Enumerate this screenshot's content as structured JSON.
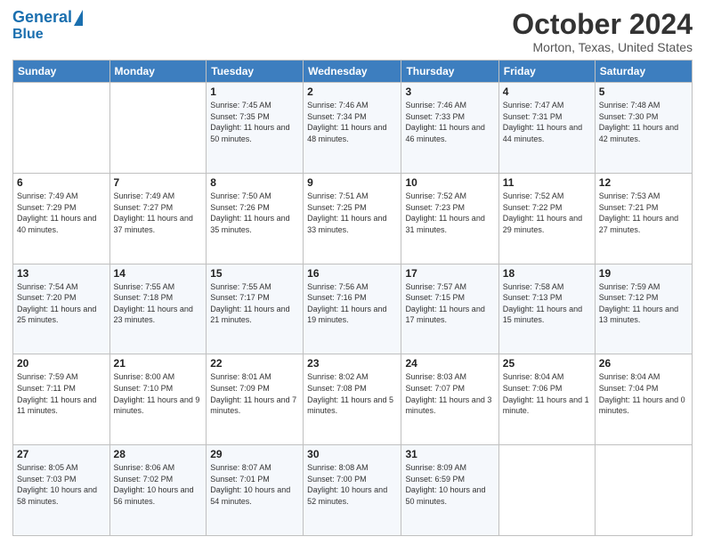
{
  "header": {
    "logo_line1": "General",
    "logo_line2": "Blue",
    "main_title": "October 2024",
    "subtitle": "Morton, Texas, United States"
  },
  "days_of_week": [
    "Sunday",
    "Monday",
    "Tuesday",
    "Wednesday",
    "Thursday",
    "Friday",
    "Saturday"
  ],
  "weeks": [
    [
      {
        "day": "",
        "info": ""
      },
      {
        "day": "",
        "info": ""
      },
      {
        "day": "1",
        "info": "Sunrise: 7:45 AM\nSunset: 7:35 PM\nDaylight: 11 hours and 50 minutes."
      },
      {
        "day": "2",
        "info": "Sunrise: 7:46 AM\nSunset: 7:34 PM\nDaylight: 11 hours and 48 minutes."
      },
      {
        "day": "3",
        "info": "Sunrise: 7:46 AM\nSunset: 7:33 PM\nDaylight: 11 hours and 46 minutes."
      },
      {
        "day": "4",
        "info": "Sunrise: 7:47 AM\nSunset: 7:31 PM\nDaylight: 11 hours and 44 minutes."
      },
      {
        "day": "5",
        "info": "Sunrise: 7:48 AM\nSunset: 7:30 PM\nDaylight: 11 hours and 42 minutes."
      }
    ],
    [
      {
        "day": "6",
        "info": "Sunrise: 7:49 AM\nSunset: 7:29 PM\nDaylight: 11 hours and 40 minutes."
      },
      {
        "day": "7",
        "info": "Sunrise: 7:49 AM\nSunset: 7:27 PM\nDaylight: 11 hours and 37 minutes."
      },
      {
        "day": "8",
        "info": "Sunrise: 7:50 AM\nSunset: 7:26 PM\nDaylight: 11 hours and 35 minutes."
      },
      {
        "day": "9",
        "info": "Sunrise: 7:51 AM\nSunset: 7:25 PM\nDaylight: 11 hours and 33 minutes."
      },
      {
        "day": "10",
        "info": "Sunrise: 7:52 AM\nSunset: 7:23 PM\nDaylight: 11 hours and 31 minutes."
      },
      {
        "day": "11",
        "info": "Sunrise: 7:52 AM\nSunset: 7:22 PM\nDaylight: 11 hours and 29 minutes."
      },
      {
        "day": "12",
        "info": "Sunrise: 7:53 AM\nSunset: 7:21 PM\nDaylight: 11 hours and 27 minutes."
      }
    ],
    [
      {
        "day": "13",
        "info": "Sunrise: 7:54 AM\nSunset: 7:20 PM\nDaylight: 11 hours and 25 minutes."
      },
      {
        "day": "14",
        "info": "Sunrise: 7:55 AM\nSunset: 7:18 PM\nDaylight: 11 hours and 23 minutes."
      },
      {
        "day": "15",
        "info": "Sunrise: 7:55 AM\nSunset: 7:17 PM\nDaylight: 11 hours and 21 minutes."
      },
      {
        "day": "16",
        "info": "Sunrise: 7:56 AM\nSunset: 7:16 PM\nDaylight: 11 hours and 19 minutes."
      },
      {
        "day": "17",
        "info": "Sunrise: 7:57 AM\nSunset: 7:15 PM\nDaylight: 11 hours and 17 minutes."
      },
      {
        "day": "18",
        "info": "Sunrise: 7:58 AM\nSunset: 7:13 PM\nDaylight: 11 hours and 15 minutes."
      },
      {
        "day": "19",
        "info": "Sunrise: 7:59 AM\nSunset: 7:12 PM\nDaylight: 11 hours and 13 minutes."
      }
    ],
    [
      {
        "day": "20",
        "info": "Sunrise: 7:59 AM\nSunset: 7:11 PM\nDaylight: 11 hours and 11 minutes."
      },
      {
        "day": "21",
        "info": "Sunrise: 8:00 AM\nSunset: 7:10 PM\nDaylight: 11 hours and 9 minutes."
      },
      {
        "day": "22",
        "info": "Sunrise: 8:01 AM\nSunset: 7:09 PM\nDaylight: 11 hours and 7 minutes."
      },
      {
        "day": "23",
        "info": "Sunrise: 8:02 AM\nSunset: 7:08 PM\nDaylight: 11 hours and 5 minutes."
      },
      {
        "day": "24",
        "info": "Sunrise: 8:03 AM\nSunset: 7:07 PM\nDaylight: 11 hours and 3 minutes."
      },
      {
        "day": "25",
        "info": "Sunrise: 8:04 AM\nSunset: 7:06 PM\nDaylight: 11 hours and 1 minute."
      },
      {
        "day": "26",
        "info": "Sunrise: 8:04 AM\nSunset: 7:04 PM\nDaylight: 11 hours and 0 minutes."
      }
    ],
    [
      {
        "day": "27",
        "info": "Sunrise: 8:05 AM\nSunset: 7:03 PM\nDaylight: 10 hours and 58 minutes."
      },
      {
        "day": "28",
        "info": "Sunrise: 8:06 AM\nSunset: 7:02 PM\nDaylight: 10 hours and 56 minutes."
      },
      {
        "day": "29",
        "info": "Sunrise: 8:07 AM\nSunset: 7:01 PM\nDaylight: 10 hours and 54 minutes."
      },
      {
        "day": "30",
        "info": "Sunrise: 8:08 AM\nSunset: 7:00 PM\nDaylight: 10 hours and 52 minutes."
      },
      {
        "day": "31",
        "info": "Sunrise: 8:09 AM\nSunset: 6:59 PM\nDaylight: 10 hours and 50 minutes."
      },
      {
        "day": "",
        "info": ""
      },
      {
        "day": "",
        "info": ""
      }
    ]
  ]
}
